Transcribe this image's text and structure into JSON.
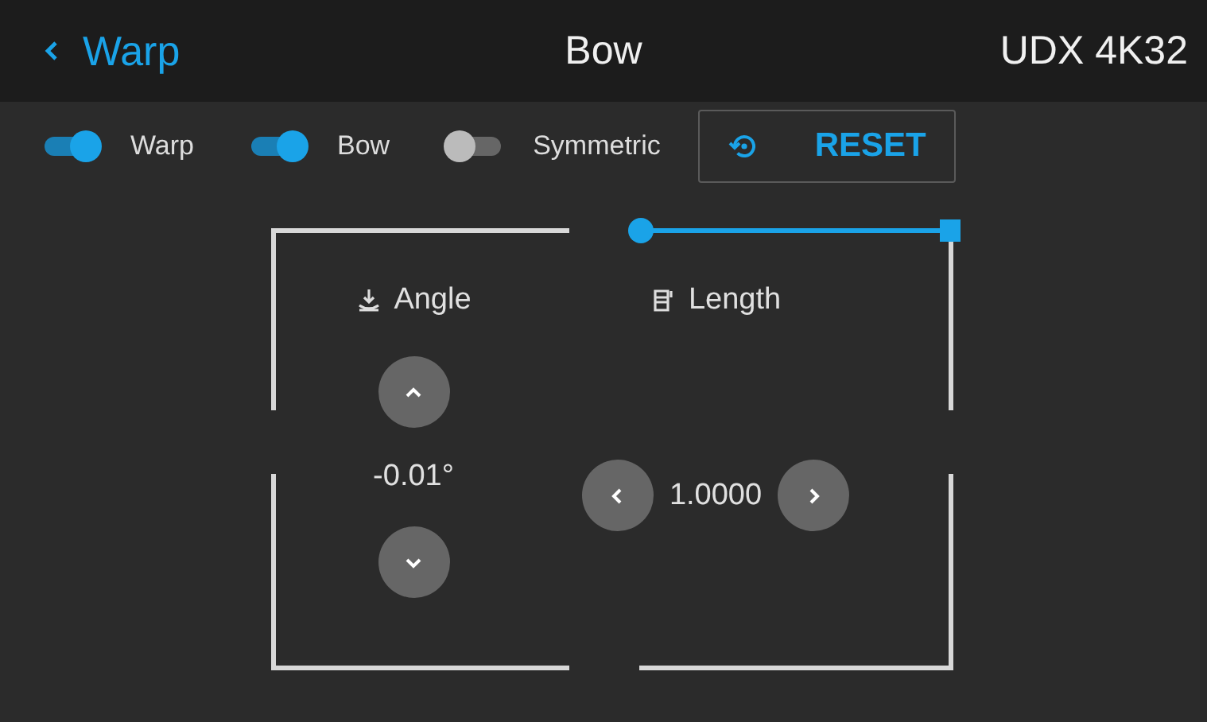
{
  "header": {
    "back_label": "Warp",
    "title": "Bow",
    "device": "UDX 4K32"
  },
  "toggles": [
    {
      "label": "Warp",
      "on": true
    },
    {
      "label": "Bow",
      "on": true
    },
    {
      "label": "Symmetric",
      "on": false
    }
  ],
  "reset_button": "RESET",
  "angle": {
    "label": "Angle",
    "value": "-0.01°"
  },
  "length": {
    "label": "Length",
    "value": "1.0000"
  }
}
